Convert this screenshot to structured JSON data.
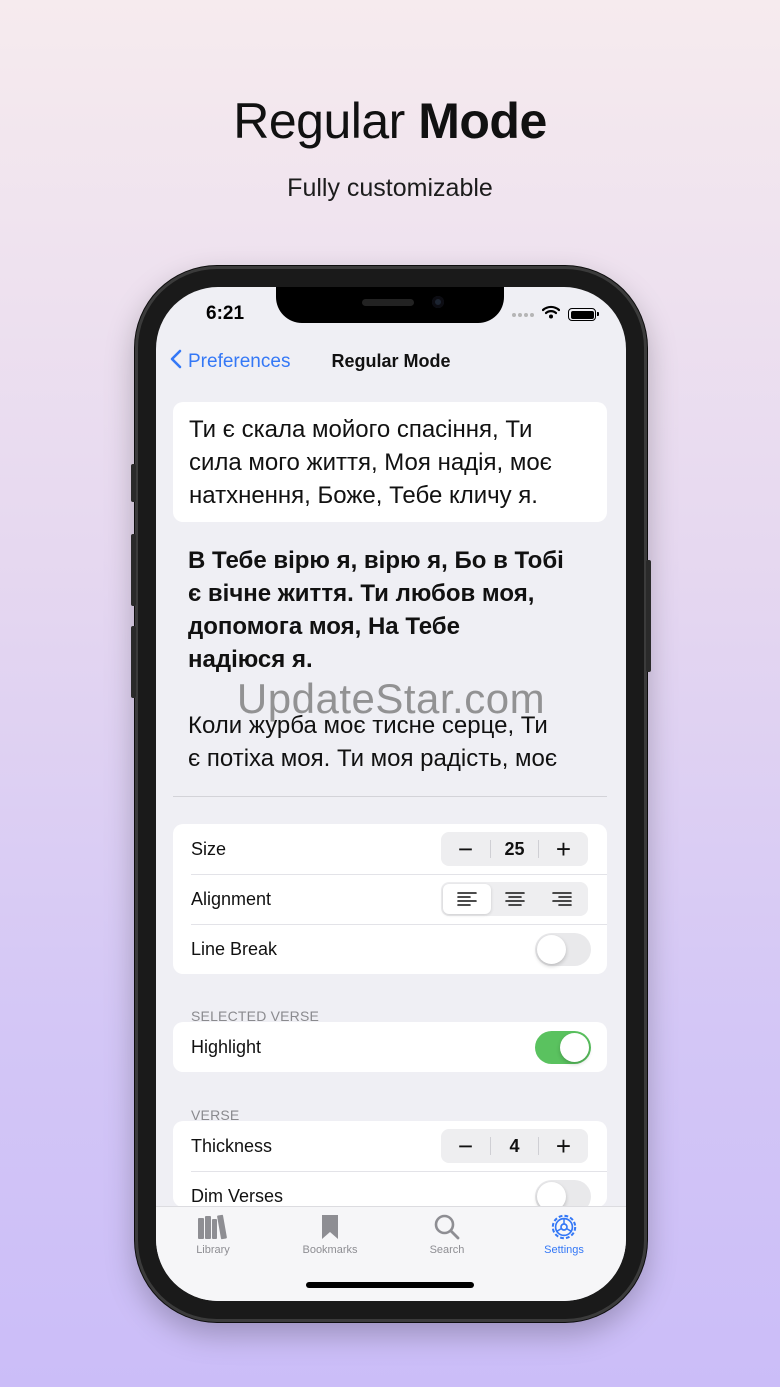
{
  "headline": {
    "light": "Regular",
    "bold": "Mode"
  },
  "subheadline": "Fully customizable",
  "status_bar": {
    "time": "6:21"
  },
  "nav": {
    "back_label": "Preferences",
    "title": "Regular Mode"
  },
  "preview": {
    "card_lines": [
      "Ти є скала мойого спасіння, Ти",
      "сила мого життя, Моя надія, моє",
      "натхнення, Боже, Тебе кличу я."
    ],
    "bold_lines": [
      "В Тебе вірю я, вірю я, Бо в Тобі",
      "є вічне життя. Ти любов моя,",
      "допомога моя, На Тебе",
      "надіюся я."
    ],
    "normal_lines": [
      "Коли журба моє тисне серце, Ти",
      "є потіха моя. Ти моя радість, моє"
    ]
  },
  "watermark": "UpdateStar.com",
  "settings": {
    "size": {
      "label": "Size",
      "value": "25",
      "minus": "−",
      "plus": "+"
    },
    "alignment": {
      "label": "Alignment",
      "selected": "left",
      "options": [
        "left",
        "center",
        "right"
      ]
    },
    "line_break": {
      "label": "Line Break",
      "on": false
    },
    "selected_verse_header": "SELECTED VERSE",
    "highlight": {
      "label": "Highlight",
      "on": true
    },
    "verse_header": "VERSE",
    "thickness": {
      "label": "Thickness",
      "value": "4",
      "minus": "−",
      "plus": "+"
    },
    "dim_verses": {
      "label": "Dim Verses",
      "on": false
    }
  },
  "tabs": [
    {
      "label": "Library",
      "icon": "library-icon",
      "active": false
    },
    {
      "label": "Bookmarks",
      "icon": "bookmark-icon",
      "active": false
    },
    {
      "label": "Search",
      "icon": "search-icon",
      "active": false
    },
    {
      "label": "Settings",
      "icon": "gear-icon",
      "active": true
    }
  ],
  "colors": {
    "accent": "#3478f6",
    "toggle_on": "#5ac25f"
  }
}
